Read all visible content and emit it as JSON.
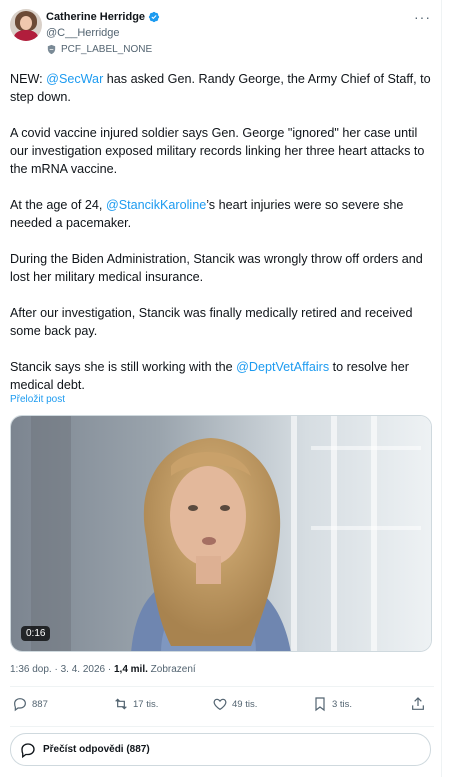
{
  "author": {
    "display_name": "Catherine Herridge",
    "handle": "@C__Herridge",
    "label": "PCF_LABEL_NONE",
    "verified_icon": "verified-badge-icon"
  },
  "tweet": {
    "p1_pre": "NEW: ",
    "p1_mention": "@SecWar",
    "p1_post": " has asked Gen. Randy George, the Army Chief of Staff, to step down.",
    "p2": "A covid vaccine injured soldier says Gen. George \"ignored\" her case until our investigation exposed military records linking her three heart attacks to the mRNA vaccine.",
    "p3_pre": "At the age of 24, ",
    "p3_mention": "@StancikKaroline",
    "p3_post": "’s heart injuries were so severe she needed a pacemaker.",
    "p4": "During the Biden Administration, Stancik was wrongly throw off orders and lost her military medical insurance.",
    "p5": "After our investigation, Stancik was finally medically retired and received some back pay.",
    "p6_pre": "Stancik says she is still working with the ",
    "p6_mention": "@DeptVetAffairs",
    "p6_post": " to resolve her medical debt.",
    "translate": "Přeložit post"
  },
  "media": {
    "duration": "0:16"
  },
  "meta": {
    "time": "1:36 dop.",
    "sep": " · ",
    "date": "3. 4. 2026",
    "views_count": "1,4 mil.",
    "views_label": "Zobrazení"
  },
  "actions": {
    "replies": "887",
    "reposts": "17 tis.",
    "likes": "49 tis.",
    "bookmarks": "3 tis."
  },
  "read_replies": "Přečíst odpovědi (887)",
  "colors": {
    "accent": "#1d9bf0",
    "text": "#0f1419",
    "muted": "#536471",
    "border": "#cfd9de"
  }
}
